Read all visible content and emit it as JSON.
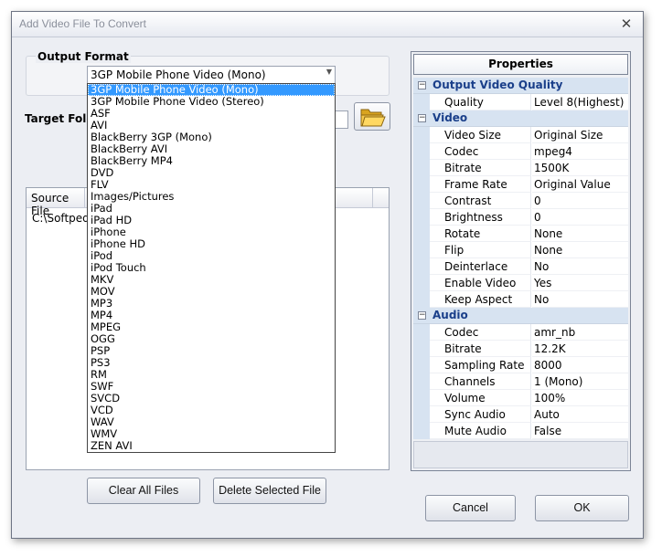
{
  "window": {
    "title": "Add Video File To Convert"
  },
  "output_format": {
    "label": "Output Format",
    "selected": "3GP Mobile Phone Video (Mono)",
    "options": [
      "3GP Mobile Phone Video (Mono)",
      "3GP Mobile Phone Video (Stereo)",
      "ASF",
      "AVI",
      "BlackBerry 3GP (Mono)",
      "BlackBerry AVI",
      "BlackBerry MP4",
      "DVD",
      "FLV",
      "Images/Pictures",
      "iPad",
      "iPad HD",
      "iPhone",
      "iPhone HD",
      "iPod",
      "iPod Touch",
      "MKV",
      "MOV",
      "MP3",
      "MP4",
      "MPEG",
      "OGG",
      "PSP",
      "PS3",
      "RM",
      "SWF",
      "SVCD",
      "VCD",
      "WAV",
      "WMV",
      "ZEN AVI"
    ]
  },
  "target_folder": {
    "label": "Target Folder"
  },
  "file_list": {
    "columns": [
      "Source File"
    ],
    "rows": [
      "C:\\Softpedia"
    ]
  },
  "buttons": {
    "clear_all": "Clear All Files",
    "delete_selected": "Delete Selected File",
    "cancel": "Cancel",
    "ok": "OK"
  },
  "properties": {
    "title": "Properties",
    "categories": [
      {
        "name": "Output Video Quality",
        "items": [
          {
            "name": "Quality",
            "value": "Level 8(Highest)"
          }
        ]
      },
      {
        "name": "Video",
        "items": [
          {
            "name": "Video Size",
            "value": "Original Size"
          },
          {
            "name": "Codec",
            "value": "mpeg4"
          },
          {
            "name": "Bitrate",
            "value": "1500K"
          },
          {
            "name": "Frame Rate",
            "value": "Original Value"
          },
          {
            "name": "Contrast",
            "value": "0"
          },
          {
            "name": "Brightness",
            "value": "0"
          },
          {
            "name": "Rotate",
            "value": "None"
          },
          {
            "name": "Flip",
            "value": "None"
          },
          {
            "name": "Deinterlace",
            "value": "No"
          },
          {
            "name": "Enable Video",
            "value": "Yes"
          },
          {
            "name": "Keep Aspect",
            "value": "No"
          }
        ]
      },
      {
        "name": "Audio",
        "items": [
          {
            "name": "Codec",
            "value": "amr_nb"
          },
          {
            "name": "Bitrate",
            "value": "12.2K"
          },
          {
            "name": "Sampling Rate",
            "value": "8000"
          },
          {
            "name": "Channels",
            "value": "1 (Mono)"
          },
          {
            "name": "Volume",
            "value": "100%"
          },
          {
            "name": "Sync Audio",
            "value": "Auto"
          },
          {
            "name": "Mute Audio",
            "value": "False"
          }
        ]
      }
    ]
  },
  "icons": {
    "close": "close-icon",
    "folder": "folder-open-icon",
    "collapse": "minus-icon"
  }
}
